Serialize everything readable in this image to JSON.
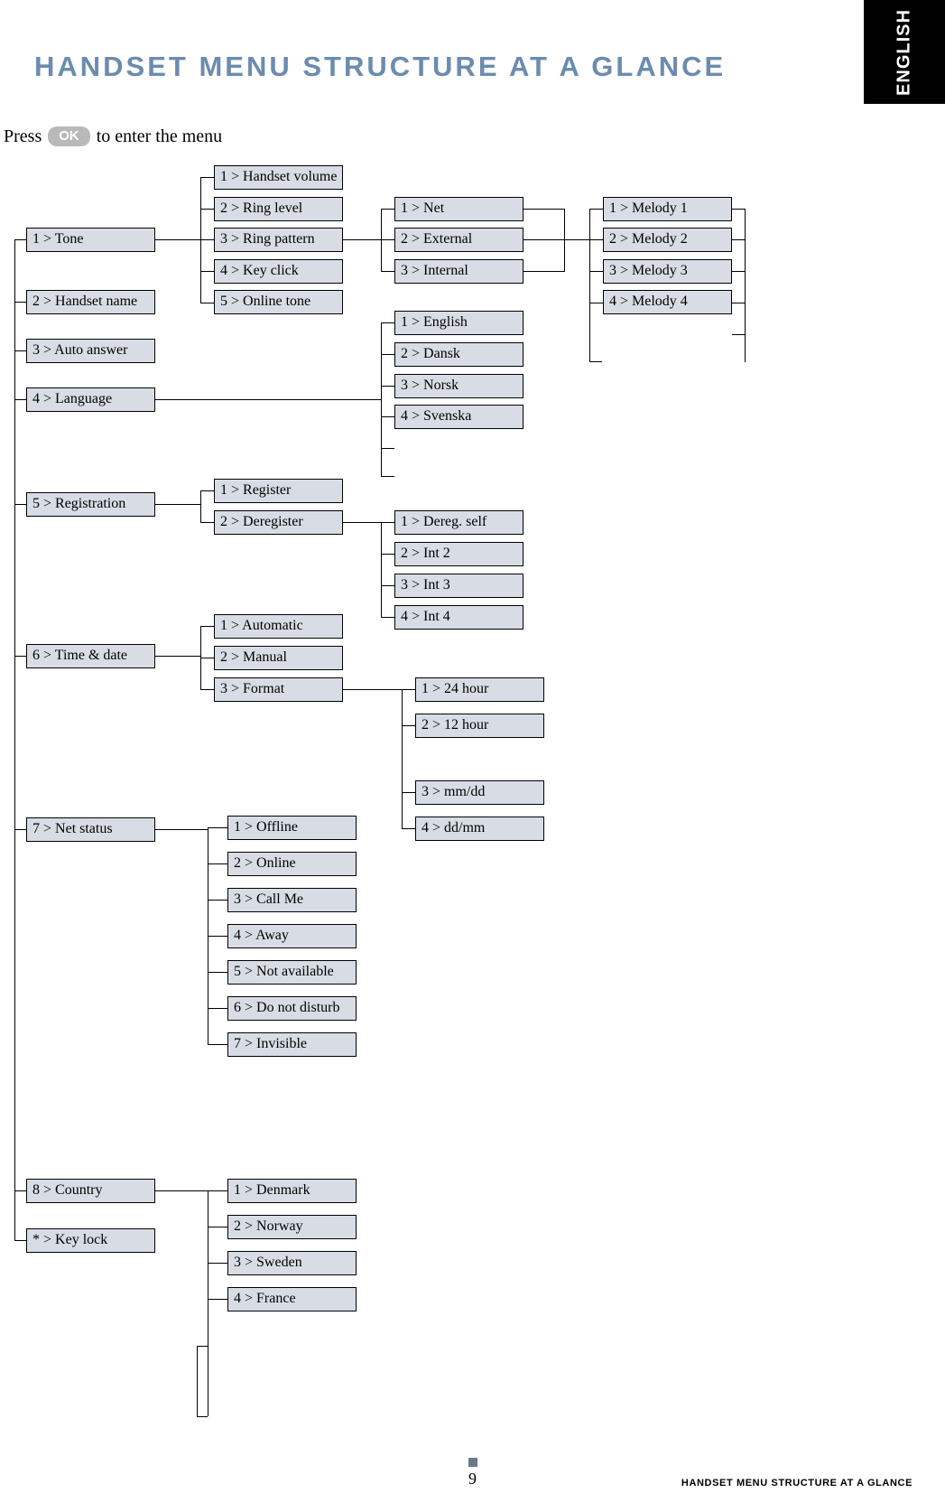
{
  "document": {
    "language_tab": "ENGLISH",
    "title": "HANDSET MENU STRUCTURE AT A GLANCE",
    "instruction_prefix": "Press ",
    "ok_label": "OK",
    "instruction_suffix": " to enter the menu",
    "page_number": "9",
    "footer_label": "HANDSET MENU STRUCTURE AT A GLANCE"
  },
  "menu": {
    "level1": [
      {
        "key": "1",
        "label": "Tone"
      },
      {
        "key": "2",
        "label": "Handset name"
      },
      {
        "key": "3",
        "label": "Auto answer"
      },
      {
        "key": "4",
        "label": "Language"
      },
      {
        "key": "5",
        "label": "Registration"
      },
      {
        "key": "6",
        "label": "Time & date"
      },
      {
        "key": "7",
        "label": "Net status"
      },
      {
        "key": "8",
        "label": "Country"
      },
      {
        "key": "*",
        "label": "Key lock"
      }
    ],
    "tone": [
      {
        "key": "1",
        "label": "Handset volume"
      },
      {
        "key": "2",
        "label": "Ring level"
      },
      {
        "key": "3",
        "label": "Ring pattern"
      },
      {
        "key": "4",
        "label": "Key click"
      },
      {
        "key": "5",
        "label": "Online tone"
      }
    ],
    "ring_pattern": [
      {
        "key": "1",
        "label": "Net"
      },
      {
        "key": "2",
        "label": "External"
      },
      {
        "key": "3",
        "label": "Internal"
      }
    ],
    "melodies": [
      {
        "key": "1",
        "label": "Melody 1"
      },
      {
        "key": "2",
        "label": "Melody 2"
      },
      {
        "key": "3",
        "label": "Melody 3"
      },
      {
        "key": "4",
        "label": "Melody 4"
      }
    ],
    "languages": [
      {
        "key": "1",
        "label": "English"
      },
      {
        "key": "2",
        "label": "Dansk"
      },
      {
        "key": "3",
        "label": "Norsk"
      },
      {
        "key": "4",
        "label": "Svenska"
      }
    ],
    "registration": [
      {
        "key": "1",
        "label": "Register"
      },
      {
        "key": "2",
        "label": "Deregister"
      }
    ],
    "deregister": [
      {
        "key": "1",
        "label": "Dereg. self"
      },
      {
        "key": "2",
        "label": "Int 2"
      },
      {
        "key": "3",
        "label": "Int 3"
      },
      {
        "key": "4",
        "label": "Int 4"
      }
    ],
    "time_date": [
      {
        "key": "1",
        "label": "Automatic"
      },
      {
        "key": "2",
        "label": "Manual"
      },
      {
        "key": "3",
        "label": "Format"
      }
    ],
    "format": [
      {
        "key": "1",
        "label": "24 hour"
      },
      {
        "key": "2",
        "label": "12 hour"
      },
      {
        "key": "3",
        "label": "mm/dd"
      },
      {
        "key": "4",
        "label": "dd/mm"
      }
    ],
    "net_status": [
      {
        "key": "1",
        "label": "Offline"
      },
      {
        "key": "2",
        "label": "Online"
      },
      {
        "key": "3",
        "label": "Call Me"
      },
      {
        "key": "4",
        "label": "Away"
      },
      {
        "key": "5",
        "label": "Not available"
      },
      {
        "key": "6",
        "label": "Do not disturb"
      },
      {
        "key": "7",
        "label": "Invisible"
      }
    ],
    "country": [
      {
        "key": "1",
        "label": "Denmark"
      },
      {
        "key": "2",
        "label": "Norway"
      },
      {
        "key": "3",
        "label": "Sweden"
      },
      {
        "key": "4",
        "label": "France"
      }
    ]
  }
}
